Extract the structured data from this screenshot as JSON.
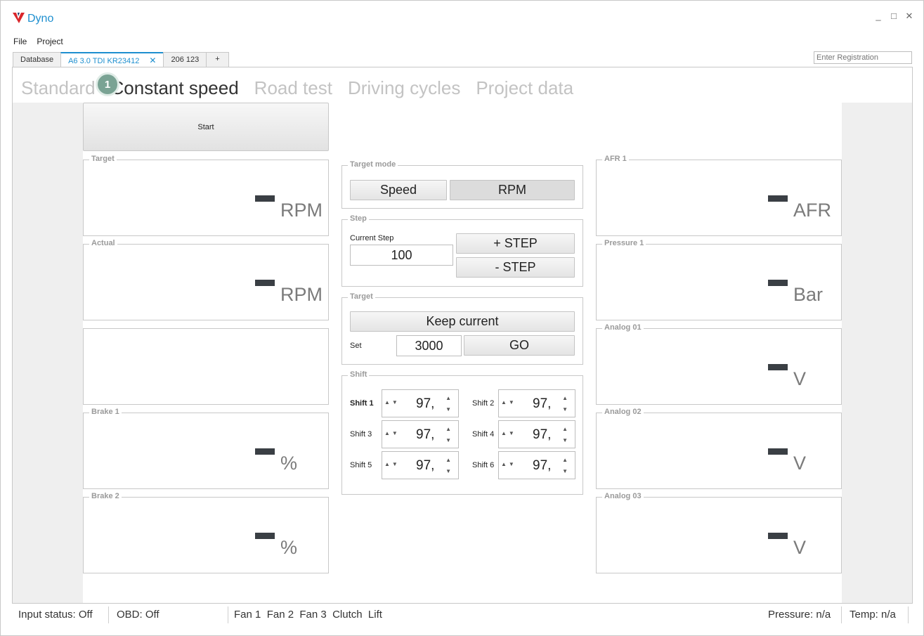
{
  "app": {
    "title": "Dyno",
    "brand_color": "#1e8fcf"
  },
  "window_controls": {
    "minimize": "_",
    "maximize": "□",
    "close": "✕"
  },
  "menu": {
    "file": "File",
    "project": "Project"
  },
  "doc_tabs": {
    "database": "Database",
    "active": "A6 3.0 TDI KR23412",
    "close": "✕",
    "second": "206 123",
    "add": "+"
  },
  "registration": {
    "placeholder": "Enter Registration"
  },
  "main_tabs": {
    "standard": "Standard",
    "constant_speed": "Constant speed",
    "road_test": "Road test",
    "driving_cycles": "Driving cycles",
    "project_data": "Project data",
    "badge": "1"
  },
  "start_button": "Start",
  "left_gauges": {
    "target": {
      "label": "Target",
      "unit": "RPM"
    },
    "actual": {
      "label": "Actual",
      "unit": "RPM"
    },
    "brake1": {
      "label": "Brake 1",
      "unit": "%"
    },
    "brake2": {
      "label": "Brake 2",
      "unit": "%"
    }
  },
  "right_gauges": {
    "afr1": {
      "label": "AFR 1",
      "unit": "AFR"
    },
    "pressure1": {
      "label": "Pressure 1",
      "unit": "Bar"
    },
    "analog01": {
      "label": "Analog 01",
      "unit": "V"
    },
    "analog02": {
      "label": "Analog 02",
      "unit": "V"
    },
    "analog03": {
      "label": "Analog 03",
      "unit": "V"
    }
  },
  "target_mode": {
    "label": "Target mode",
    "speed": "Speed",
    "rpm": "RPM"
  },
  "step": {
    "label": "Step",
    "current_label": "Current Step",
    "current_value": "100",
    "plus": "+ STEP",
    "minus": "- STEP"
  },
  "target": {
    "label": "Target",
    "keep_current": "Keep current",
    "set_label": "Set",
    "set_value": "3000",
    "go": "GO"
  },
  "shift": {
    "label": "Shift",
    "items": [
      {
        "label": "Shift 1",
        "value": "97,"
      },
      {
        "label": "Shift 2",
        "value": "97,"
      },
      {
        "label": "Shift 3",
        "value": "97,"
      },
      {
        "label": "Shift 4",
        "value": "97,"
      },
      {
        "label": "Shift 5",
        "value": "97,"
      },
      {
        "label": "Shift 6",
        "value": "97,"
      }
    ]
  },
  "status": {
    "input": "Input status: Off",
    "obd": "OBD: Off",
    "fans": "Fan 1  Fan 2  Fan 3  Clutch  Lift",
    "pressure": "Pressure: n/a",
    "temp": "Temp: n/a"
  }
}
